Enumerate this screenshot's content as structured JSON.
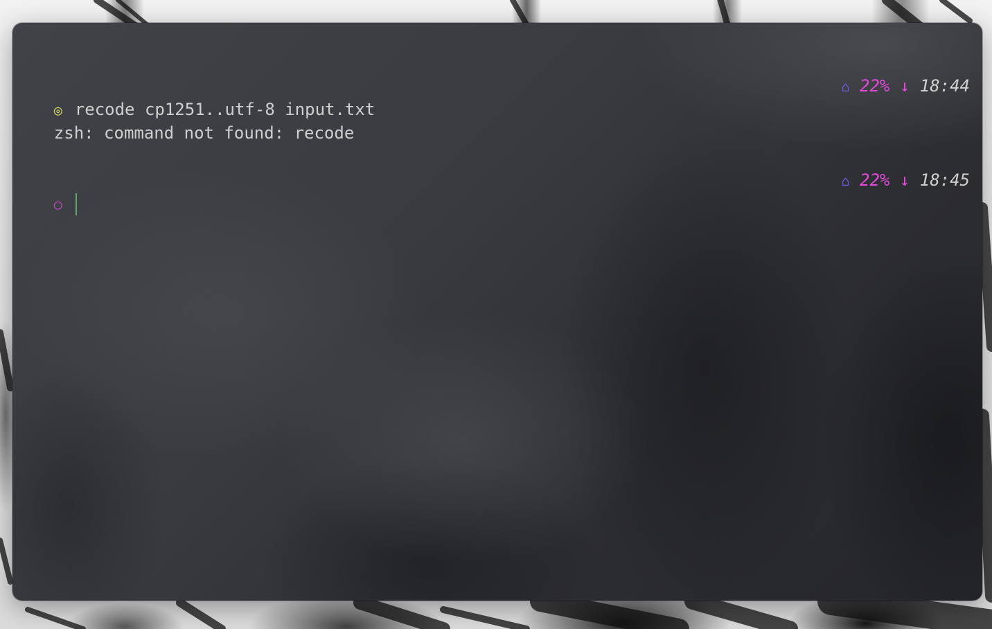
{
  "terminal": {
    "history": [
      {
        "prompt_symbol": "◎",
        "command": "recode cp1251..utf-8 input.txt",
        "output": "zsh: command not found: recode",
        "status": {
          "home_icon": "⌂",
          "battery": "22%",
          "charge_arrow": "↓",
          "time": "18:44"
        }
      }
    ],
    "current": {
      "prompt_symbol": "○",
      "input": "",
      "status": {
        "home_icon": "⌂",
        "battery": "22%",
        "charge_arrow": "↓",
        "time": "18:45"
      }
    }
  },
  "colors": {
    "prompt_done": "#d8d86a",
    "prompt_idle": "#c64dc6",
    "battery": "#e04bd8",
    "home_icon": "#6b5be0",
    "cursor": "#5fa866"
  },
  "icons": {
    "home": "home-icon",
    "charge": "arrow-down-icon"
  }
}
